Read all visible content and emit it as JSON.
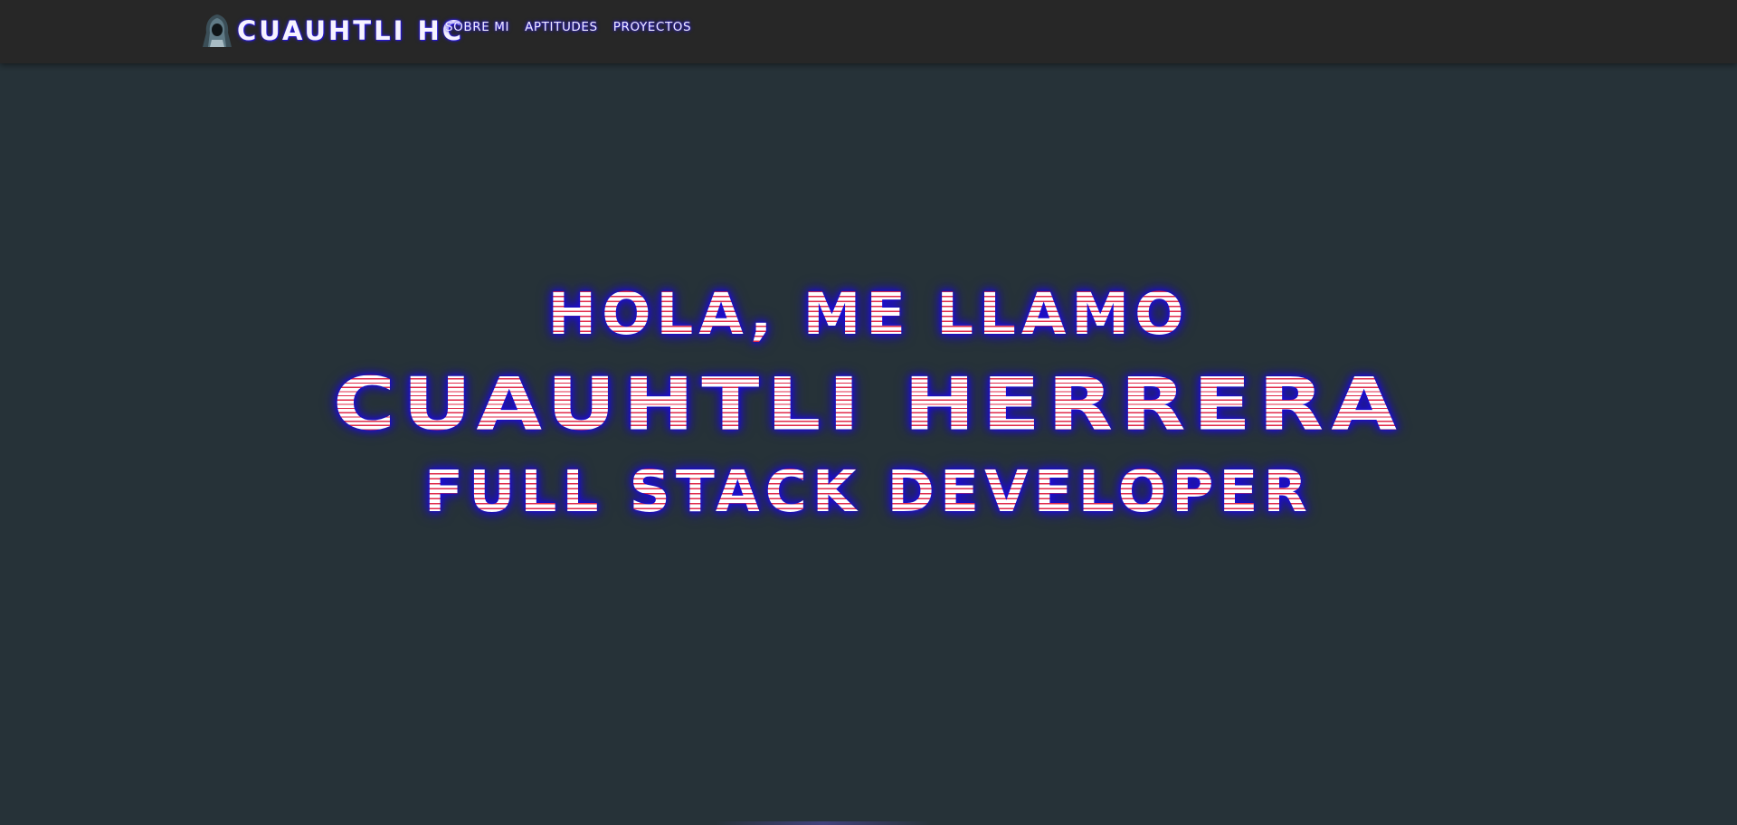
{
  "navbar": {
    "brand_logo_icon": "hooded-hacker-icon",
    "brand_text": "CUAUHTLI HC",
    "links": [
      {
        "label": "SOBRE MI"
      },
      {
        "label": "APTITUDES"
      },
      {
        "label": "PROYECTOS"
      }
    ]
  },
  "hero": {
    "greeting": "HOLA, ME LLAMO",
    "name": "CUAUHTLI HERRERA",
    "role": "FULL STACK DEVELOPER"
  },
  "colors": {
    "background": "#263238",
    "navbar": "#272727",
    "text_fill": "#ffffff",
    "stripe": "#e02a4a",
    "glow": "#2010e0"
  }
}
